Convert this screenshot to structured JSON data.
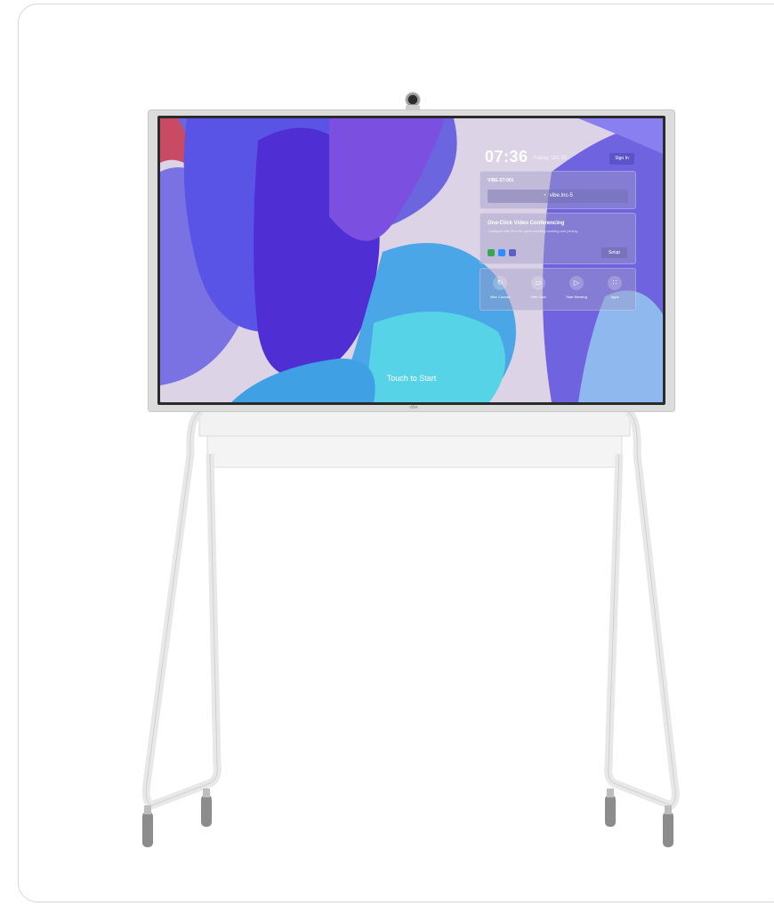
{
  "device": {
    "brand_label": "vibe"
  },
  "home_screen": {
    "time": "07:36",
    "date": "Friday, Oct 20",
    "sign_in_label": "Sign In",
    "room_name": "VIBE-ST-001",
    "wifi_network": "vibe.Inc-5",
    "conferencing": {
      "title": "One-Click Video Conferencing",
      "subtitle": "Configure this Vibe for quick meeting booking and joining.",
      "setup_label": "Setup",
      "app_icons": [
        "google-meet-icon",
        "zoom-icon",
        "teams-icon"
      ]
    },
    "quick_actions": [
      {
        "label": "Vibe Canvas",
        "icon": "canvas-icon"
      },
      {
        "label": "Vibe Cast",
        "icon": "cast-icon"
      },
      {
        "label": "Start Meeting",
        "icon": "video-camera-icon"
      },
      {
        "label": "Apps",
        "icon": "apps-grid-icon"
      }
    ],
    "touch_prompt": "Touch to Start"
  },
  "colors": {
    "accent": "#5b54c9",
    "stand": "#efefef"
  }
}
